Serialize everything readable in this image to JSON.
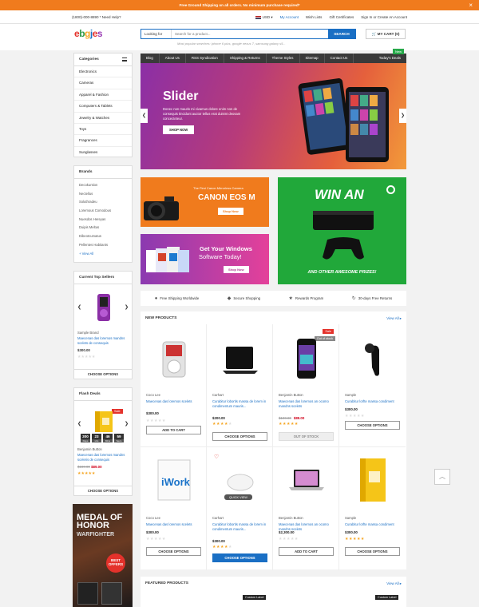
{
  "notice": {
    "text": "Free Ground Shipping on all orders. No minimum purchase required*",
    "close": "×"
  },
  "util": {
    "phone": "(1800)-000-8890 * Need Help?",
    "currency": "USD ▾",
    "links": [
      "My Account",
      "Wish Lists",
      "Gift Certificates",
      "Sign In or Create An Account"
    ]
  },
  "logo": [
    "e",
    "b",
    "g",
    "e",
    "s",
    ""
  ],
  "logo_text": "ebgjes",
  "search": {
    "label": "Looking for",
    "placeholder": "Search for a product...",
    "button": "SEARCH",
    "popular": "Most popular searches: iphone 6 plus, google nexus 7, samsung galaxy s5..."
  },
  "cart": "MY CART (0)",
  "categories": {
    "title": "Categories",
    "items": [
      "Electronics",
      "Cameras",
      "Apparel & Fashion",
      "Computers & Tablets",
      "Jewelry & Watches",
      "Toys",
      "Fragrances",
      "Sunglasses"
    ]
  },
  "brands": {
    "title": "Brands",
    "items": [
      "Decokuntion",
      "Nectellus",
      "Soluthradeu",
      "Loremous Comodous",
      "Nuesdos Hereyas",
      "Duipis Meltus",
      "Dibeotcumatus",
      "Pellentes Habitants"
    ],
    "view_all": "View All"
  },
  "top_sellers": {
    "title": "Current Top Sellers",
    "brand": "Sample Brand",
    "name": "Maecenas das loremos mandns scelets de consequis",
    "price": "$300.00",
    "button": "CHOOSE OPTIONS"
  },
  "flash_deals": {
    "title": "Flash Deals",
    "badge": "Sale",
    "countdown": [
      {
        "v": "300",
        "l": "Days"
      },
      {
        "v": "23",
        "l": "Hrs"
      },
      {
        "v": "46",
        "l": "Mins"
      },
      {
        "v": "59",
        "l": "Secs"
      }
    ],
    "brand": "Benjamin Button",
    "name": "Maecenas das loremos mandns sceleris de consequis",
    "old_price": "$100.00",
    "price": "$89.00",
    "button": "CHOOSE OPTIONS"
  },
  "promo_banner": {
    "title": "MEDAL OF HONOR",
    "subtitle": "WARFIGHTER",
    "badge": "BEST OFFERS"
  },
  "nav": {
    "items": [
      "Blog",
      "About Us",
      "RSS Syndication",
      "Shipping & Returns",
      "Theme Styles",
      "Sitemap",
      "Contact Us"
    ],
    "deals": "Today's Deals",
    "new_badge": "New"
  },
  "slider": {
    "title": "Slider",
    "text": "Donec non mauris mi vivamus dolore enim non de consequis tincidunt auctor tellus erat duismt deosam concecteteur.",
    "button": "SHOP NOW"
  },
  "banner_canon": {
    "kicker": "The First Canon Mirrorless Camera",
    "title": "CANON EOS M",
    "button": "Shop Now"
  },
  "banner_windows": {
    "title": "Get Your Windows",
    "subtitle": "Software Today!",
    "button": "Shop Now"
  },
  "banner_xbox": {
    "title": "WIN AN",
    "subtitle": "AND OTHER AWESOME PRIZES!"
  },
  "features": [
    "Free Shipping Worldwide",
    "Secure Shopping",
    "Rewards Program",
    "30-days Free Returns"
  ],
  "new_products": {
    "title": "NEW PRODUCTS",
    "view_all": "View All ▸",
    "items": [
      {
        "brand": "Coco Lee",
        "name": "Maecenas das loremos scelets",
        "price": "$300.00",
        "old": "",
        "stars": 0,
        "button": "ADD TO CART",
        "badge": ""
      },
      {
        "brand": "Carhart",
        "name": "Curabitur lobortis massa de lorem in condimentum mauris...",
        "price": "$200.00",
        "old": "",
        "stars": 4,
        "button": "CHOOSE OPTIONS",
        "badge": ""
      },
      {
        "brand": "Benjamin Button",
        "name": "Maecenas das loremos an ocomo mandns scelets",
        "price": "$89.00",
        "old": "$100.00",
        "stars": 5,
        "button": "OUT OF STOCK",
        "badge": "Sale",
        "badge2": "Out of stock"
      },
      {
        "brand": "Sample",
        "name": "Curabitur lorfte massa condiment",
        "price": "$300.00",
        "old": "",
        "stars": 0,
        "button": "CHOOSE OPTIONS",
        "badge": ""
      },
      {
        "brand": "Coco Lee",
        "name": "Maecenas das loremos scelets",
        "price": "$300.00",
        "old": "",
        "stars": 0,
        "button": "CHOOSE OPTIONS",
        "badge": ""
      },
      {
        "brand": "Carhart",
        "name": "Curabitur lobortis massa de lorem in condimentum mauris...",
        "price": "$300.00",
        "old": "",
        "stars": 4,
        "button": "CHOOSE OPTIONS",
        "badge": "",
        "quick": "QUICK VIEW"
      },
      {
        "brand": "Benjamin Button",
        "name": "Maecenas das loremos an ocomo mandns scelets",
        "price": "$2,300.00",
        "old": "",
        "stars": 0,
        "button": "ADD TO CART",
        "badge": ""
      },
      {
        "brand": "Sample",
        "name": "Curabitur lorfte massa condiment",
        "price": "$300.00",
        "old": "",
        "stars": 5,
        "button": "CHOOSE OPTIONS",
        "badge": ""
      }
    ]
  },
  "featured": {
    "title": "FEATURED PRODUCTS",
    "view_all": "View All ▸",
    "label": "Custom Label"
  },
  "colors": {
    "accent": "#1a6fc4",
    "notice": "#f07b1d",
    "sale": "#e4322b",
    "green": "#27a94a",
    "star": "#f5a623"
  }
}
